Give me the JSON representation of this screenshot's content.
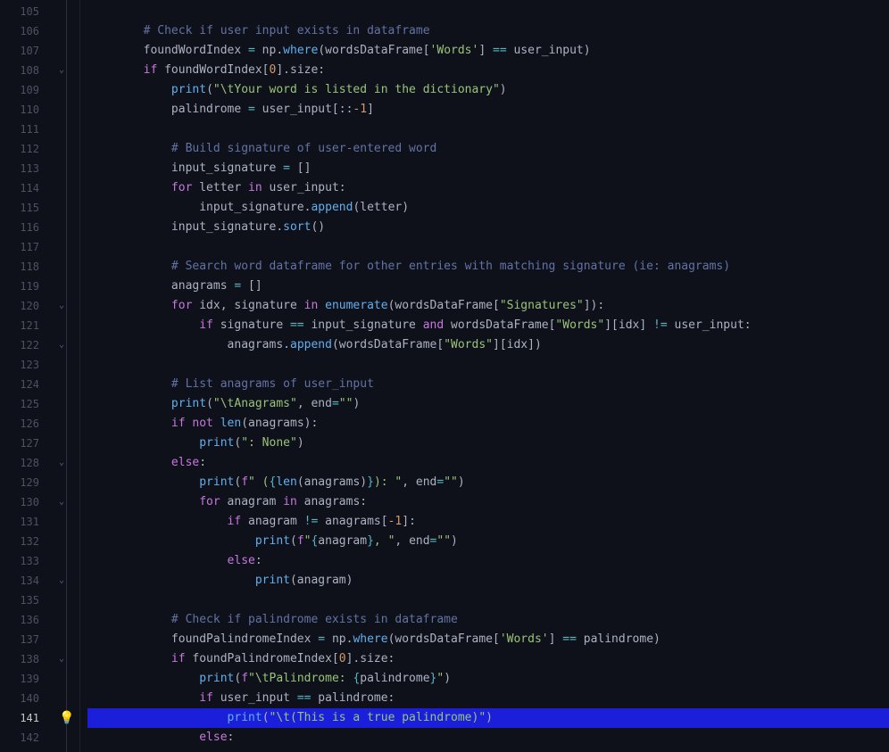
{
  "lines": {
    "start": 105,
    "end": 142,
    "active": 141
  },
  "fold_marks": [
    108,
    120,
    122,
    128,
    130,
    134,
    138
  ],
  "bulb_line": 141,
  "code_lines": [
    {
      "n": 105,
      "tokens": []
    },
    {
      "n": 106,
      "tokens": [
        {
          "t": "        ",
          "c": ""
        },
        {
          "t": "# Check if user input exists in dataframe",
          "c": "cm"
        }
      ]
    },
    {
      "n": 107,
      "tokens": [
        {
          "t": "        ",
          "c": ""
        },
        {
          "t": "foundWordIndex ",
          "c": "va"
        },
        {
          "t": "=",
          "c": "op"
        },
        {
          "t": " np.",
          "c": "va"
        },
        {
          "t": "where",
          "c": "fn"
        },
        {
          "t": "(wordsDataFrame[",
          "c": "va"
        },
        {
          "t": "'Words'",
          "c": "st"
        },
        {
          "t": "] ",
          "c": "va"
        },
        {
          "t": "==",
          "c": "op"
        },
        {
          "t": " user_input)",
          "c": "va"
        }
      ]
    },
    {
      "n": 108,
      "tokens": [
        {
          "t": "        ",
          "c": ""
        },
        {
          "t": "if",
          "c": "kw"
        },
        {
          "t": " foundWordIndex[",
          "c": "va"
        },
        {
          "t": "0",
          "c": "num"
        },
        {
          "t": "].size:",
          "c": "va"
        }
      ]
    },
    {
      "n": 109,
      "tokens": [
        {
          "t": "            ",
          "c": ""
        },
        {
          "t": "print",
          "c": "fn"
        },
        {
          "t": "(",
          "c": "va"
        },
        {
          "t": "\"\\tYour word is listed in the dictionary\"",
          "c": "st"
        },
        {
          "t": ")",
          "c": "va"
        }
      ]
    },
    {
      "n": 110,
      "tokens": [
        {
          "t": "            ",
          "c": ""
        },
        {
          "t": "palindrome ",
          "c": "va"
        },
        {
          "t": "=",
          "c": "op"
        },
        {
          "t": " user_input[::",
          "c": "va"
        },
        {
          "t": "-1",
          "c": "num"
        },
        {
          "t": "]",
          "c": "va"
        }
      ]
    },
    {
      "n": 111,
      "tokens": []
    },
    {
      "n": 112,
      "tokens": [
        {
          "t": "            ",
          "c": ""
        },
        {
          "t": "# Build signature of user-entered word",
          "c": "cm"
        }
      ]
    },
    {
      "n": 113,
      "tokens": [
        {
          "t": "            ",
          "c": ""
        },
        {
          "t": "input_signature ",
          "c": "va"
        },
        {
          "t": "=",
          "c": "op"
        },
        {
          "t": " []",
          "c": "va"
        }
      ]
    },
    {
      "n": 114,
      "tokens": [
        {
          "t": "            ",
          "c": ""
        },
        {
          "t": "for",
          "c": "kw"
        },
        {
          "t": " letter ",
          "c": "va"
        },
        {
          "t": "in",
          "c": "kw"
        },
        {
          "t": " user_input:",
          "c": "va"
        }
      ]
    },
    {
      "n": 115,
      "tokens": [
        {
          "t": "                ",
          "c": ""
        },
        {
          "t": "input_signature.",
          "c": "va"
        },
        {
          "t": "append",
          "c": "fn"
        },
        {
          "t": "(letter)",
          "c": "va"
        }
      ]
    },
    {
      "n": 116,
      "tokens": [
        {
          "t": "            ",
          "c": ""
        },
        {
          "t": "input_signature.",
          "c": "va"
        },
        {
          "t": "sort",
          "c": "fn"
        },
        {
          "t": "()",
          "c": "va"
        }
      ]
    },
    {
      "n": 117,
      "tokens": []
    },
    {
      "n": 118,
      "tokens": [
        {
          "t": "            ",
          "c": ""
        },
        {
          "t": "# Search word dataframe for other entries with matching signature (ie: anagrams)",
          "c": "cm"
        }
      ]
    },
    {
      "n": 119,
      "tokens": [
        {
          "t": "            ",
          "c": ""
        },
        {
          "t": "anagrams ",
          "c": "va"
        },
        {
          "t": "=",
          "c": "op"
        },
        {
          "t": " []",
          "c": "va"
        }
      ]
    },
    {
      "n": 120,
      "tokens": [
        {
          "t": "            ",
          "c": ""
        },
        {
          "t": "for",
          "c": "kw"
        },
        {
          "t": " idx, signature ",
          "c": "va"
        },
        {
          "t": "in",
          "c": "kw"
        },
        {
          "t": " ",
          "c": ""
        },
        {
          "t": "enumerate",
          "c": "fn"
        },
        {
          "t": "(wordsDataFrame[",
          "c": "va"
        },
        {
          "t": "\"Signatures\"",
          "c": "st"
        },
        {
          "t": "]):",
          "c": "va"
        }
      ]
    },
    {
      "n": 121,
      "tokens": [
        {
          "t": "                ",
          "c": ""
        },
        {
          "t": "if",
          "c": "kw"
        },
        {
          "t": " signature ",
          "c": "va"
        },
        {
          "t": "==",
          "c": "op"
        },
        {
          "t": " input_signature ",
          "c": "va"
        },
        {
          "t": "and",
          "c": "kw"
        },
        {
          "t": " wordsDataFrame[",
          "c": "va"
        },
        {
          "t": "\"Words\"",
          "c": "st"
        },
        {
          "t": "][idx] ",
          "c": "va"
        },
        {
          "t": "!=",
          "c": "op"
        },
        {
          "t": " user_input:",
          "c": "va"
        }
      ]
    },
    {
      "n": 122,
      "tokens": [
        {
          "t": "                    ",
          "c": ""
        },
        {
          "t": "anagrams.",
          "c": "va"
        },
        {
          "t": "append",
          "c": "fn"
        },
        {
          "t": "(wordsDataFrame[",
          "c": "va"
        },
        {
          "t": "\"Words\"",
          "c": "st"
        },
        {
          "t": "][idx])",
          "c": "va"
        }
      ]
    },
    {
      "n": 123,
      "tokens": []
    },
    {
      "n": 124,
      "tokens": [
        {
          "t": "            ",
          "c": ""
        },
        {
          "t": "# List anagrams of user_input",
          "c": "cm"
        }
      ]
    },
    {
      "n": 125,
      "tokens": [
        {
          "t": "            ",
          "c": ""
        },
        {
          "t": "print",
          "c": "fn"
        },
        {
          "t": "(",
          "c": "va"
        },
        {
          "t": "\"\\tAnagrams\"",
          "c": "st"
        },
        {
          "t": ", ",
          "c": "va"
        },
        {
          "t": "end",
          "c": "va"
        },
        {
          "t": "=",
          "c": "op"
        },
        {
          "t": "\"\"",
          "c": "st"
        },
        {
          "t": ")",
          "c": "va"
        }
      ]
    },
    {
      "n": 126,
      "tokens": [
        {
          "t": "            ",
          "c": ""
        },
        {
          "t": "if",
          "c": "kw"
        },
        {
          "t": " ",
          "c": ""
        },
        {
          "t": "not",
          "c": "kw"
        },
        {
          "t": " ",
          "c": ""
        },
        {
          "t": "len",
          "c": "fn"
        },
        {
          "t": "(anagrams):",
          "c": "va"
        }
      ]
    },
    {
      "n": 127,
      "tokens": [
        {
          "t": "                ",
          "c": ""
        },
        {
          "t": "print",
          "c": "fn"
        },
        {
          "t": "(",
          "c": "va"
        },
        {
          "t": "\": None\"",
          "c": "st"
        },
        {
          "t": ")",
          "c": "va"
        }
      ]
    },
    {
      "n": 128,
      "tokens": [
        {
          "t": "            ",
          "c": ""
        },
        {
          "t": "else",
          "c": "kw"
        },
        {
          "t": ":",
          "c": "va"
        }
      ]
    },
    {
      "n": 129,
      "tokens": [
        {
          "t": "                ",
          "c": ""
        },
        {
          "t": "print",
          "c": "fn"
        },
        {
          "t": "(",
          "c": "va"
        },
        {
          "t": "f",
          "c": "fs"
        },
        {
          "t": "\" (",
          "c": "st"
        },
        {
          "t": "{",
          "c": "brace"
        },
        {
          "t": "len",
          "c": "fn"
        },
        {
          "t": "(anagrams)",
          "c": "va"
        },
        {
          "t": "}",
          "c": "brace"
        },
        {
          "t": "): \"",
          "c": "st"
        },
        {
          "t": ", ",
          "c": "va"
        },
        {
          "t": "end",
          "c": "va"
        },
        {
          "t": "=",
          "c": "op"
        },
        {
          "t": "\"\"",
          "c": "st"
        },
        {
          "t": ")",
          "c": "va"
        }
      ]
    },
    {
      "n": 130,
      "tokens": [
        {
          "t": "                ",
          "c": ""
        },
        {
          "t": "for",
          "c": "kw"
        },
        {
          "t": " anagram ",
          "c": "va"
        },
        {
          "t": "in",
          "c": "kw"
        },
        {
          "t": " anagrams:",
          "c": "va"
        }
      ]
    },
    {
      "n": 131,
      "tokens": [
        {
          "t": "                    ",
          "c": ""
        },
        {
          "t": "if",
          "c": "kw"
        },
        {
          "t": " anagram ",
          "c": "va"
        },
        {
          "t": "!=",
          "c": "op"
        },
        {
          "t": " anagrams[",
          "c": "va"
        },
        {
          "t": "-1",
          "c": "num"
        },
        {
          "t": "]:",
          "c": "va"
        }
      ]
    },
    {
      "n": 132,
      "tokens": [
        {
          "t": "                        ",
          "c": ""
        },
        {
          "t": "print",
          "c": "fn"
        },
        {
          "t": "(",
          "c": "va"
        },
        {
          "t": "f",
          "c": "fs"
        },
        {
          "t": "\"",
          "c": "st"
        },
        {
          "t": "{",
          "c": "brace"
        },
        {
          "t": "anagram",
          "c": "va"
        },
        {
          "t": "}",
          "c": "brace"
        },
        {
          "t": ", \"",
          "c": "st"
        },
        {
          "t": ", ",
          "c": "va"
        },
        {
          "t": "end",
          "c": "va"
        },
        {
          "t": "=",
          "c": "op"
        },
        {
          "t": "\"\"",
          "c": "st"
        },
        {
          "t": ")",
          "c": "va"
        }
      ]
    },
    {
      "n": 133,
      "tokens": [
        {
          "t": "                    ",
          "c": ""
        },
        {
          "t": "else",
          "c": "kw"
        },
        {
          "t": ":",
          "c": "va"
        }
      ]
    },
    {
      "n": 134,
      "tokens": [
        {
          "t": "                        ",
          "c": ""
        },
        {
          "t": "print",
          "c": "fn"
        },
        {
          "t": "(anagram)",
          "c": "va"
        }
      ]
    },
    {
      "n": 135,
      "tokens": []
    },
    {
      "n": 136,
      "tokens": [
        {
          "t": "            ",
          "c": ""
        },
        {
          "t": "# Check if palindrome exists in dataframe",
          "c": "cm"
        }
      ]
    },
    {
      "n": 137,
      "tokens": [
        {
          "t": "            ",
          "c": ""
        },
        {
          "t": "foundPalindromeIndex ",
          "c": "va"
        },
        {
          "t": "=",
          "c": "op"
        },
        {
          "t": " np.",
          "c": "va"
        },
        {
          "t": "where",
          "c": "fn"
        },
        {
          "t": "(wordsDataFrame[",
          "c": "va"
        },
        {
          "t": "'Words'",
          "c": "st"
        },
        {
          "t": "] ",
          "c": "va"
        },
        {
          "t": "==",
          "c": "op"
        },
        {
          "t": " palindrome)",
          "c": "va"
        }
      ]
    },
    {
      "n": 138,
      "tokens": [
        {
          "t": "            ",
          "c": ""
        },
        {
          "t": "if",
          "c": "kw"
        },
        {
          "t": " foundPalindromeIndex[",
          "c": "va"
        },
        {
          "t": "0",
          "c": "num"
        },
        {
          "t": "].size:",
          "c": "va"
        }
      ]
    },
    {
      "n": 139,
      "tokens": [
        {
          "t": "                ",
          "c": ""
        },
        {
          "t": "print",
          "c": "fn"
        },
        {
          "t": "(",
          "c": "va"
        },
        {
          "t": "f",
          "c": "fs"
        },
        {
          "t": "\"\\tPalindrome: ",
          "c": "st"
        },
        {
          "t": "{",
          "c": "brace"
        },
        {
          "t": "palindrome",
          "c": "va"
        },
        {
          "t": "}",
          "c": "brace"
        },
        {
          "t": "\"",
          "c": "st"
        },
        {
          "t": ")",
          "c": "va"
        }
      ]
    },
    {
      "n": 140,
      "tokens": [
        {
          "t": "                ",
          "c": ""
        },
        {
          "t": "if",
          "c": "kw"
        },
        {
          "t": " user_input ",
          "c": "va"
        },
        {
          "t": "==",
          "c": "op"
        },
        {
          "t": " palindrome:",
          "c": "va"
        }
      ]
    },
    {
      "n": 141,
      "hl": true,
      "tokens": [
        {
          "t": "                    ",
          "c": ""
        },
        {
          "t": "print",
          "c": "fn"
        },
        {
          "t": "(",
          "c": "va"
        },
        {
          "t": "\"\\t(This is a true palindrome)\"",
          "c": "st"
        },
        {
          "t": ")",
          "c": "va"
        }
      ]
    },
    {
      "n": 142,
      "tokens": [
        {
          "t": "                ",
          "c": ""
        },
        {
          "t": "else",
          "c": "kw"
        },
        {
          "t": ":",
          "c": "va"
        }
      ]
    }
  ]
}
